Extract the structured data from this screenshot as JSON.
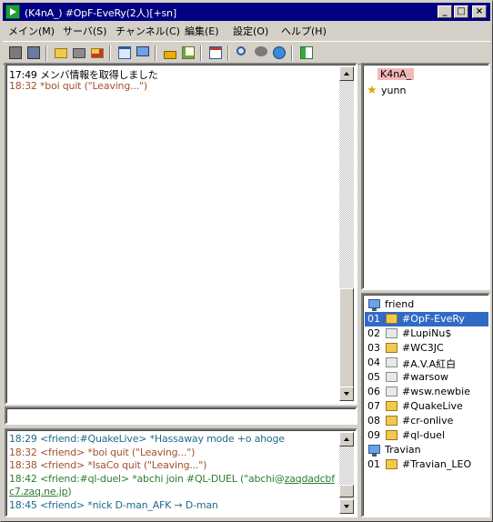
{
  "window": {
    "title": "(K4nA_) #OpF-EveRy(2人)[+sn]"
  },
  "titlebar_buttons": {
    "minimize": "_",
    "maximize": "□",
    "close": "×"
  },
  "menu": [
    "メイン(M)",
    "サーバ(S)",
    "チャンネル(C)",
    "編集(E)",
    "設定(O)",
    "ヘルプ(H)"
  ],
  "toolbar_icons": [
    "connect-icon",
    "disconnect-icon",
    "folder-open-icon",
    "folder-gray-icon",
    "folder-add-icon",
    "window-icon",
    "monitor-icon",
    "lock-icon",
    "edit-icon",
    "checklist-icon",
    "search-icon",
    "chat-bubble-icon",
    "globe-icon",
    "exit-icon"
  ],
  "channel_log": [
    {
      "time": "17:49",
      "text": "メンバ情報を取得しました",
      "kind": "sys"
    },
    {
      "time": "18:32",
      "text": "*boi quit (\"Leaving...\")",
      "kind": "quit"
    }
  ],
  "input": {
    "value": ""
  },
  "priv_log": [
    {
      "time": "18:29",
      "prefix": "<friend:#QuakeLive>",
      "text": " *Hassaway mode +o ahoge",
      "kind": "nick"
    },
    {
      "time": "18:32",
      "prefix": "<friend>",
      "text": " *boi quit (\"Leaving...\")",
      "kind": "quit"
    },
    {
      "time": "18:38",
      "prefix": "<friend>",
      "text": " *IsaCo quit (\"Leaving...\")",
      "kind": "quit"
    },
    {
      "time": "18:42",
      "prefix": "<friend:#ql-duel>",
      "text": " *abchi join #QL-DUEL (\"abchi@",
      "link": "zaqdadcbf",
      "kind": "join"
    },
    {
      "time": "",
      "prefix": "",
      "text": "",
      "link": "c7.zaq.ne.jp",
      "tail": ")",
      "kind": "join"
    },
    {
      "time": "18:45",
      "prefix": "<friend>",
      "text": " *nick D-man_AFK → D-man",
      "kind": "nick"
    }
  ],
  "nicks": [
    {
      "name": "K4nA_",
      "self": true
    },
    {
      "name": "yunn",
      "op": true
    }
  ],
  "servers": [
    {
      "name": "friend",
      "channels": [
        {
          "num": "01",
          "name": "#OpF-EveRy",
          "folder": "yellow",
          "selected": true
        },
        {
          "num": "02",
          "name": "#LupiNu$",
          "folder": "gray"
        },
        {
          "num": "03",
          "name": "#WC3JC",
          "folder": "yellow"
        },
        {
          "num": "04",
          "name": "#A.V.A紅白",
          "folder": "gray"
        },
        {
          "num": "05",
          "name": "#warsow",
          "folder": "gray"
        },
        {
          "num": "06",
          "name": "#wsw.newbie",
          "folder": "gray"
        },
        {
          "num": "07",
          "name": "#QuakeLive",
          "folder": "yellow"
        },
        {
          "num": "08",
          "name": "#cr-onlive",
          "folder": "yellow"
        },
        {
          "num": "09",
          "name": "#ql-duel",
          "folder": "yellow"
        }
      ]
    },
    {
      "name": "Travian",
      "channels": [
        {
          "num": "01",
          "name": "#Travian_LEO",
          "folder": "yellow"
        }
      ]
    }
  ],
  "colors": {
    "titlebar": "#000080",
    "selection": "#316ac5",
    "self_nick_bg": "#f4b8b8",
    "quit": "#a0522d",
    "join": "#2e7d32",
    "nick": "#1f6b8a"
  }
}
